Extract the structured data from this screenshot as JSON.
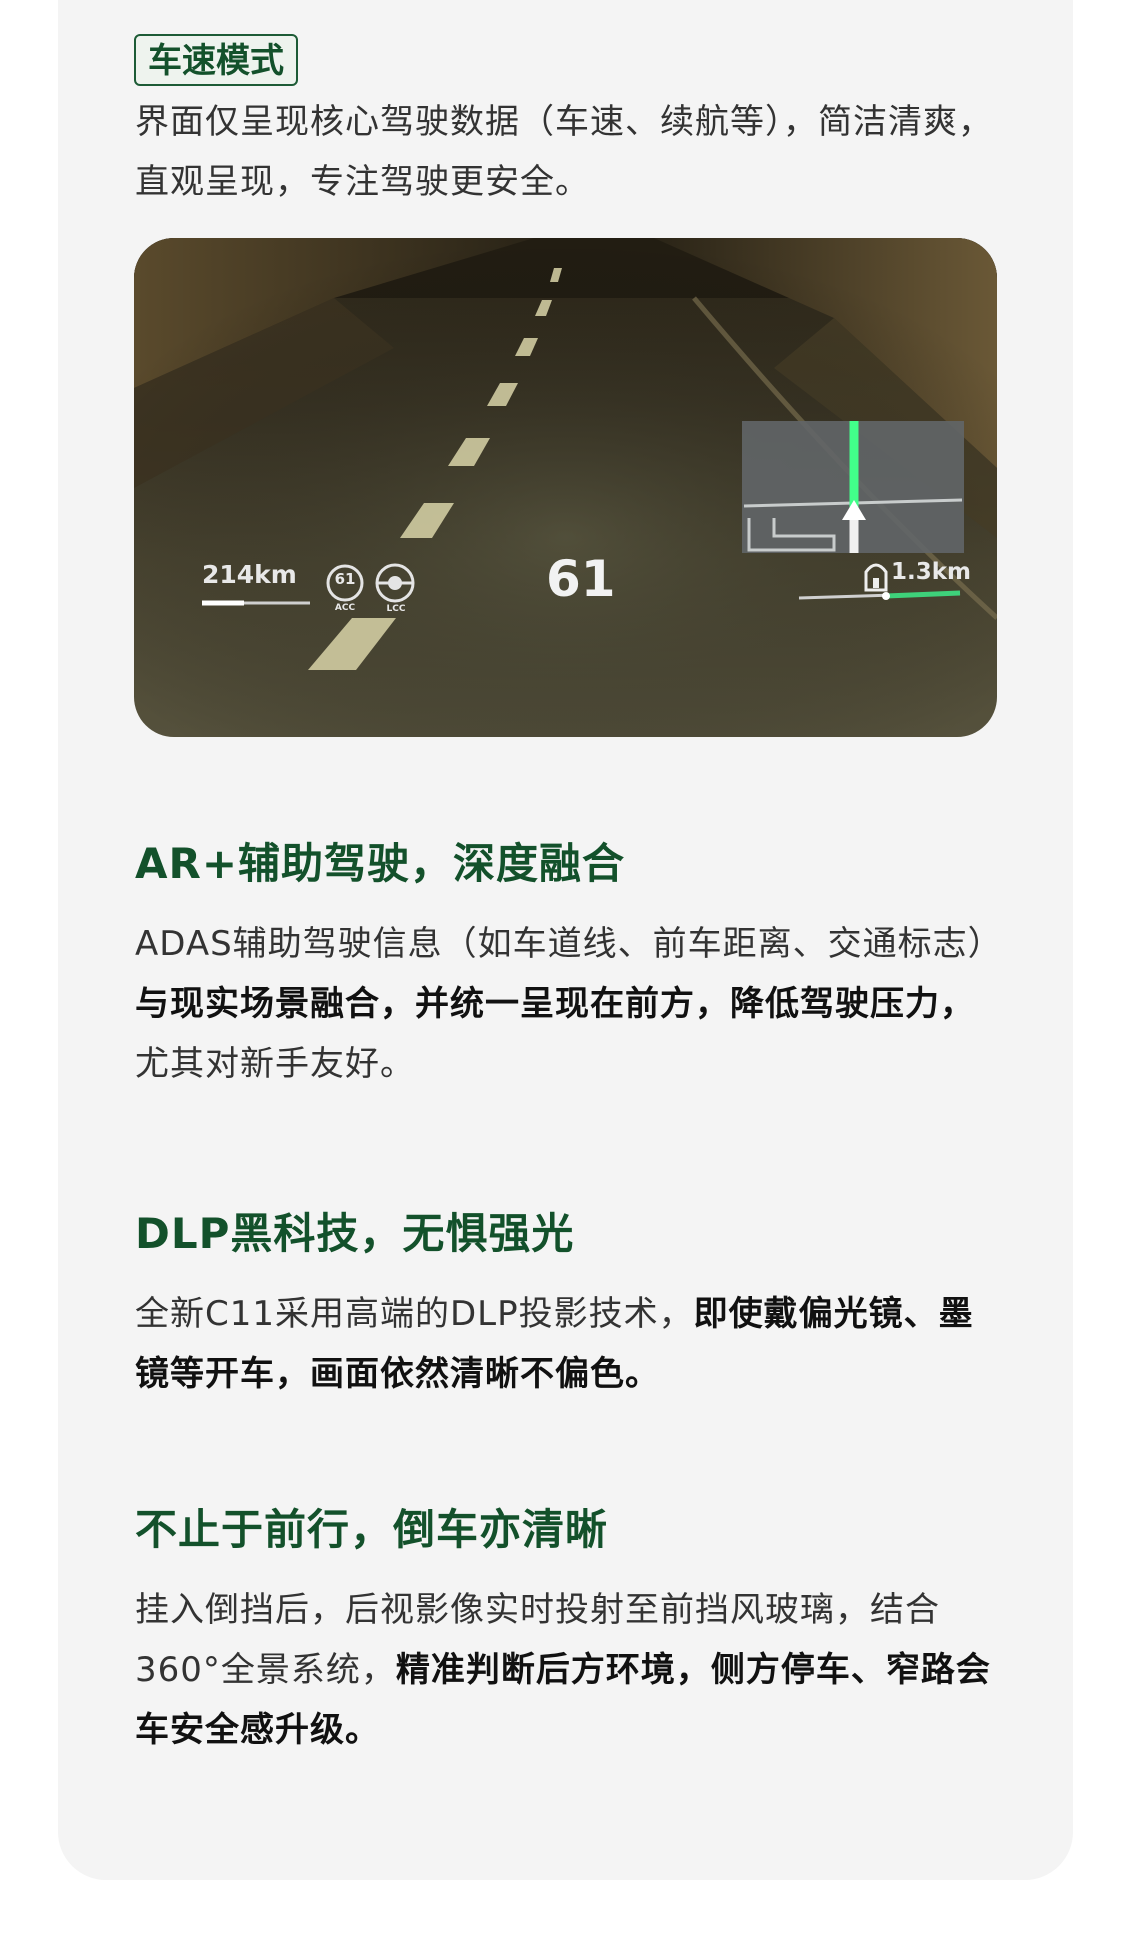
{
  "speed_mode": {
    "tag": "车速模式",
    "desc": "界面仅呈现核心驾驶数据（车速、续航等），简洁清爽，直观呈现，专注驾驶更安全。"
  },
  "hud": {
    "range": "214km",
    "acc_speed": "61",
    "acc_label": "ACC",
    "lcc_label": "LCC",
    "speed": "61",
    "tunnel_distance": "1.3km",
    "colors": {
      "accent": "#2ecc71",
      "hud_text": "#e8e8e8"
    },
    "icons": [
      "acc-icon",
      "lcc-steering-icon",
      "tunnel-icon",
      "nav-arrow-icon"
    ]
  },
  "ar": {
    "heading": "AR+辅助驾驶，深度融合",
    "p1": "ADAS辅助驾驶信息（如车道线、前车距离、交通标志）",
    "p1_bold": "与现实场景融合，并统一呈现在前方，降低驾驶压力，",
    "p1_tail": "尤其对新手友好。"
  },
  "dlp": {
    "heading": "DLP黑科技，无惧强光",
    "p1": "全新C11采用高端的DLP投影技术，",
    "p1_bold": "即使戴偏光镜、墨镜等开车，画面依然清晰不偏色。"
  },
  "reverse": {
    "heading": "不止于前行，倒车亦清晰",
    "p1": "挂入倒挡后，后视影像实时投射至前挡风玻璃，结合360°全景系统，",
    "p1_bold": "精准判断后方环境，侧方停车、窄路会车安全感升级。"
  },
  "theme": {
    "heading_color": "#13512b",
    "card_bg": "#f4f4f4"
  }
}
